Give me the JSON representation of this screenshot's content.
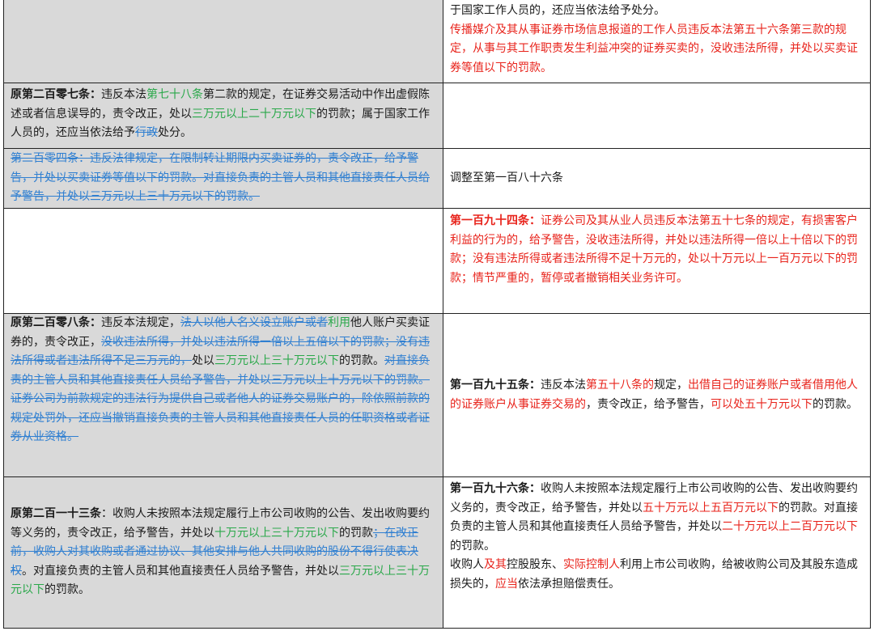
{
  "rows": [
    {
      "left": [],
      "right": [
        {
          "t": "于国家工作人员的，还应当依法给予处分。",
          "c": ""
        },
        {
          "br": true
        },
        {
          "t": "传播媒介及其从事证券市场信息报道的工作人员违反本法第五十六条第三款的规定，从事与其工作职责发生利益冲突的证券买卖的，没收违法所得，并处以买卖证券等值以下的罚款。",
          "c": "r"
        }
      ]
    },
    {
      "left": [
        {
          "t": "原第二百零七条：",
          "c": "b"
        },
        {
          "t": "违反本法",
          "c": ""
        },
        {
          "t": "第七十八条",
          "c": "g"
        },
        {
          "t": "第二款的规定，在证券交易活动中作出虚假陈述或者信息误导的，责令改正，处以",
          "c": ""
        },
        {
          "t": "三万元以上二十万元以下",
          "c": "g"
        },
        {
          "t": "的罚款；属于国家工作人员的，还应当依法给予",
          "c": ""
        },
        {
          "t": "行政",
          "c": "bl st"
        },
        {
          "t": "处分。",
          "c": ""
        }
      ],
      "right": []
    },
    {
      "left": [
        {
          "t": "第二百零四条：违反法律规定，在限制转让期限内买卖证券的，责令改正，给予警告，并处以买卖证券等值以下的罚款。对直接负责的主管人员和其他直接责任人员给予警告，并处以三万元以上三十万元以下的罚款。",
          "c": "bl st"
        }
      ],
      "right": [
        {
          "t": "调整至第一百八十六条",
          "c": ""
        }
      ]
    },
    {
      "left": [],
      "right": [
        {
          "t": "第一百九十四条：",
          "c": "r b"
        },
        {
          "t": "证券公司及其从业人员违反本法第五十七条的规定，有损害客户利益的行为的，给予警告，没收违法所得，并处以违法所得一倍以上十倍以下的罚款；没有违法所得或者违法所得不足十万元的，处以十万元以上一百万元以下的罚款；情节严重的，暂停或者撤销相关业务许可。",
          "c": "r"
        }
      ]
    },
    {
      "left": [
        {
          "t": "原第二百零八条：",
          "c": "b"
        },
        {
          "t": "违反本法规定，",
          "c": ""
        },
        {
          "t": "法人以他人名义设立账户或者",
          "c": "bl st"
        },
        {
          "t": "利用",
          "c": "g"
        },
        {
          "t": "他人账户买卖证券的，责令改正，",
          "c": ""
        },
        {
          "t": "没收违法所得，并处以违法所得一倍以上五倍以下的罚款；没有违法所得或者违法所得不足三万元的，",
          "c": "bl st"
        },
        {
          "t": "处以",
          "c": ""
        },
        {
          "t": "三万元以上三十万元以下",
          "c": "g"
        },
        {
          "t": "的罚款。",
          "c": ""
        },
        {
          "t": "对直接负责的主管人员和其他直接责任人员给予警告，并处以三万元以上十万元以下的罚款。",
          "c": "bl st"
        },
        {
          "br": true
        },
        {
          "t": "证券公司为前款规定的违法行为提供自己或者他人的证券交易账户的，除依照前款的规定处罚外，还应当撤销直接负责的主管人员和其他直接责任人员的任职资格或者证券从业资格。",
          "c": "bl st"
        }
      ],
      "right": [
        {
          "t": "第一百九十五条：",
          "c": "b"
        },
        {
          "t": "违反本法",
          "c": ""
        },
        {
          "t": "第五十八条的",
          "c": "r"
        },
        {
          "t": "规定，",
          "c": ""
        },
        {
          "t": "出借自己的证券账户或者借用他人的证券账户从事证券交易的",
          "c": "r"
        },
        {
          "t": "，责令改正，给予警告，",
          "c": ""
        },
        {
          "t": "可以处五十万元以下",
          "c": "r"
        },
        {
          "t": "的罚款。",
          "c": ""
        }
      ]
    },
    {
      "left": [
        {
          "t": "原第二百一十三条",
          "c": "b"
        },
        {
          "t": "：收购人未按照本法规定履行上市公司收购的公告、发出收购要约等义务的，责令改正，给予警告，并处以",
          "c": ""
        },
        {
          "t": "十万元以上三十万元以下",
          "c": "g"
        },
        {
          "t": "的罚款",
          "c": ""
        },
        {
          "t": "；在改正前，收购人对其收购或者通过协议、其他安排与他人共同收购的股份不得行使表决权",
          "c": "bl st"
        },
        {
          "t": "。对直接负责的主管人员和其他直接责任人员给予警告，并处以",
          "c": ""
        },
        {
          "t": "三万元以上三十万元以下",
          "c": "g"
        },
        {
          "t": "的罚款。",
          "c": ""
        }
      ],
      "right": [
        {
          "t": "第一百九十六条：",
          "c": "b"
        },
        {
          "t": "收购人未按照本法规定履行上市公司收购的公告、发出收购要约义务的，责令改正，给予警告，并处以",
          "c": ""
        },
        {
          "t": "五十万元以上五百万元以下",
          "c": "r"
        },
        {
          "t": "的罚款。对直接负责的主管人员和其他直接责任人员给予警告，并处以",
          "c": ""
        },
        {
          "t": "二十万元以上二百万元以下",
          "c": "r"
        },
        {
          "t": "的罚款。",
          "c": ""
        },
        {
          "br": true
        },
        {
          "t": "收购人",
          "c": ""
        },
        {
          "t": "及其",
          "c": "r"
        },
        {
          "t": "控股股东、",
          "c": ""
        },
        {
          "t": "实际控制人",
          "c": "r"
        },
        {
          "t": "利用上市公司收购，给被收购公司及其股东造成损失的，",
          "c": ""
        },
        {
          "t": "应当",
          "c": "r"
        },
        {
          "t": "依法承担赔偿责任。",
          "c": ""
        }
      ]
    }
  ]
}
